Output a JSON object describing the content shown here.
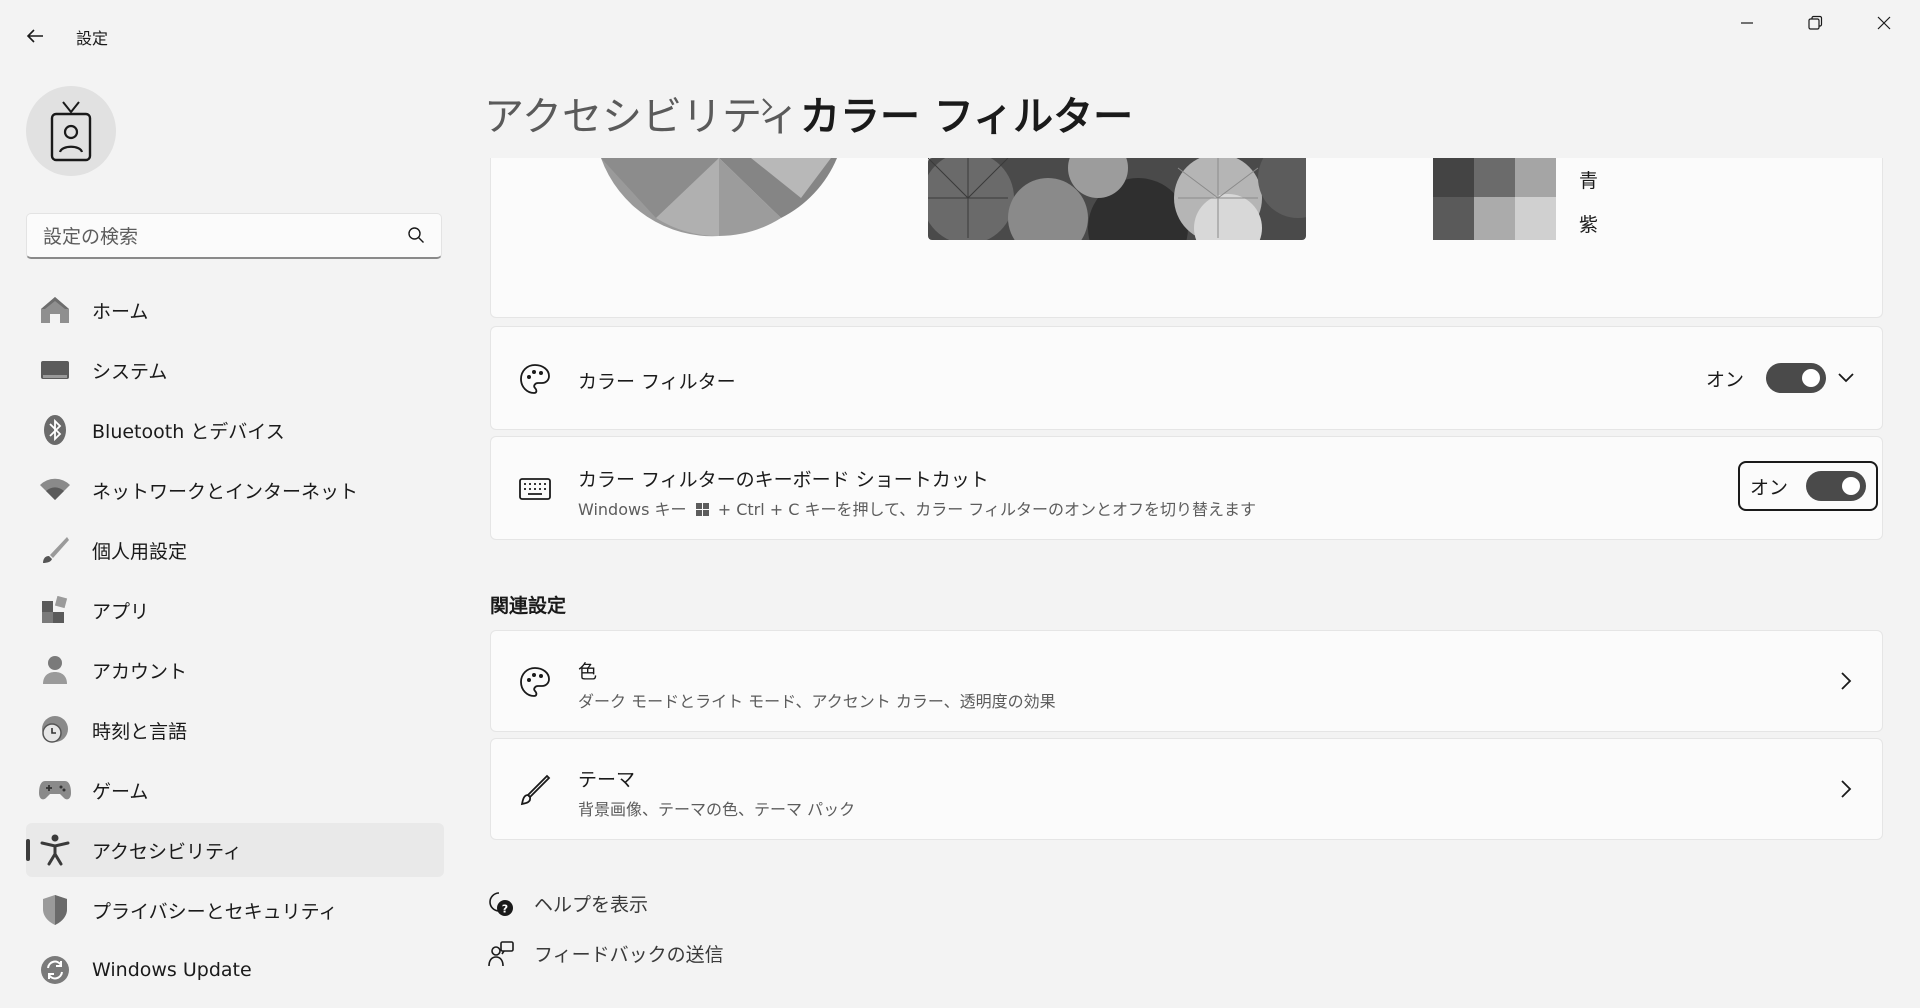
{
  "window": {
    "title": "設定",
    "minimize_label": "minimize-icon",
    "maximize_label": "restore-icon",
    "close_label": "close-icon"
  },
  "search": {
    "placeholder": "設定の検索",
    "value": ""
  },
  "sidebar": {
    "items": [
      {
        "label": "ホーム",
        "icon": "home-icon"
      },
      {
        "label": "システム",
        "icon": "system-icon"
      },
      {
        "label": "Bluetooth とデバイス",
        "icon": "bluetooth-icon"
      },
      {
        "label": "ネットワークとインターネット",
        "icon": "wifi-icon"
      },
      {
        "label": "個人用設定",
        "icon": "brush-icon"
      },
      {
        "label": "アプリ",
        "icon": "apps-icon"
      },
      {
        "label": "アカウント",
        "icon": "account-icon"
      },
      {
        "label": "時刻と言語",
        "icon": "time-language-icon"
      },
      {
        "label": "ゲーム",
        "icon": "gamepad-icon"
      },
      {
        "label": "アクセシビリティ",
        "icon": "accessibility-icon",
        "active": true
      },
      {
        "label": "プライバシーとセキュリティ",
        "icon": "shield-icon"
      },
      {
        "label": "Windows Update",
        "icon": "update-icon"
      }
    ]
  },
  "breadcrumb": {
    "parent": "アクセシビリティ",
    "current": "カラー フィルター"
  },
  "preview": {
    "swatch_labels": [
      "青",
      "紫"
    ]
  },
  "color_filter": {
    "title": "カラー フィルター",
    "toggle_label": "オン",
    "toggle_on": true
  },
  "shortcut": {
    "title": "カラー フィルターのキーボード ショートカット",
    "subtitle_before": "Windows キー",
    "subtitle_after": "+ Ctrl + C キーを押して、カラー フィルターのオンとオフを切り替えます",
    "toggle_label": "オン",
    "toggle_on": true
  },
  "related": {
    "heading": "関連設定",
    "items": [
      {
        "title": "色",
        "subtitle": "ダーク モードとライト モード、アクセント カラー、透明度の効果"
      },
      {
        "title": "テーマ",
        "subtitle": "背景画像、テーマの色、テーマ パック"
      }
    ]
  },
  "footer": {
    "help": "ヘルプを表示",
    "feedback": "フィードバックの送信"
  }
}
